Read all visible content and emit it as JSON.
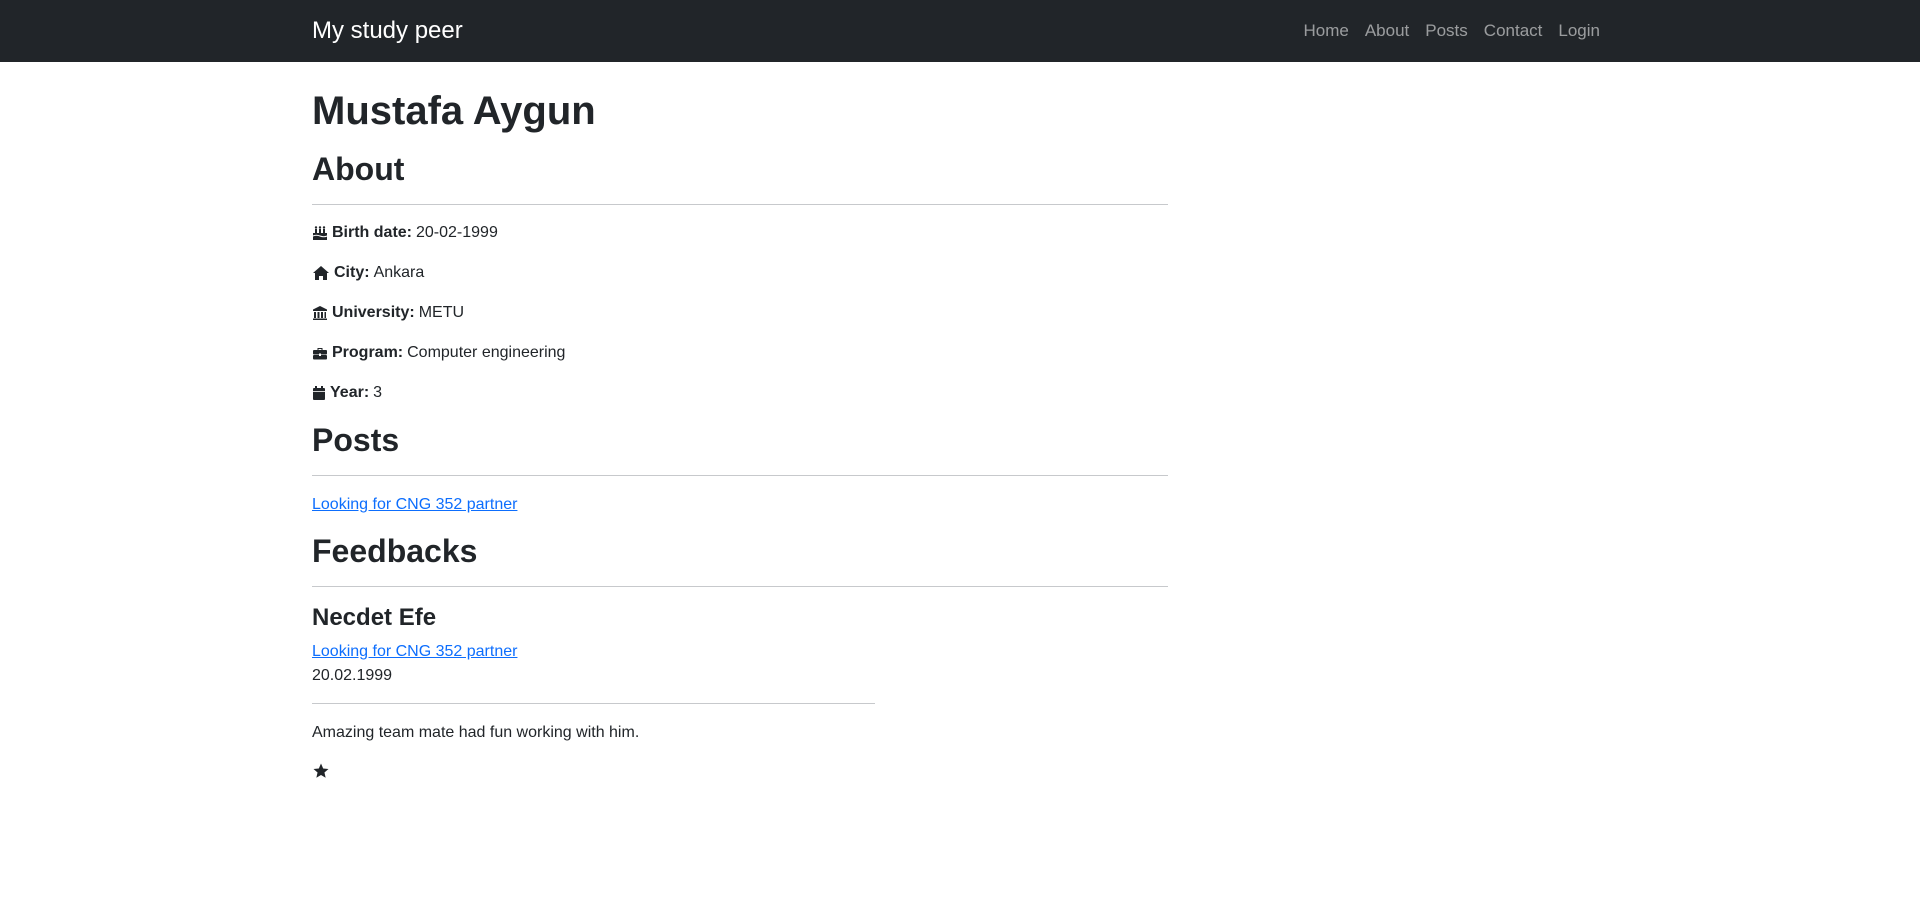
{
  "navbar": {
    "brand": "My study peer",
    "links": [
      "Home",
      "About",
      "Posts",
      "Contact",
      "Login"
    ]
  },
  "profile": {
    "name": "Mustafa Aygun"
  },
  "about": {
    "heading": "About",
    "items": [
      {
        "icon": "birthday-cake-icon",
        "label": "Birth date:",
        "value": "20-02-1999"
      },
      {
        "icon": "home-icon",
        "label": "City:",
        "value": "Ankara"
      },
      {
        "icon": "university-icon",
        "label": "University:",
        "value": "METU"
      },
      {
        "icon": "briefcase-icon",
        "label": "Program:",
        "value": "Computer engineering"
      },
      {
        "icon": "calendar-icon",
        "label": "Year:",
        "value": "3"
      }
    ]
  },
  "posts": {
    "heading": "Posts",
    "items": [
      "Looking for CNG 352 partner"
    ]
  },
  "feedbacks": {
    "heading": "Feedbacks",
    "items": [
      {
        "author": "Necdet Efe",
        "post": "Looking for CNG 352 partner",
        "date": "20.02.1999",
        "text": "Amazing team mate had fun working with him.",
        "rating": 1
      }
    ]
  },
  "colors": {
    "navbar_bg": "#212529",
    "link": "#0d6efd",
    "text": "#212529"
  }
}
